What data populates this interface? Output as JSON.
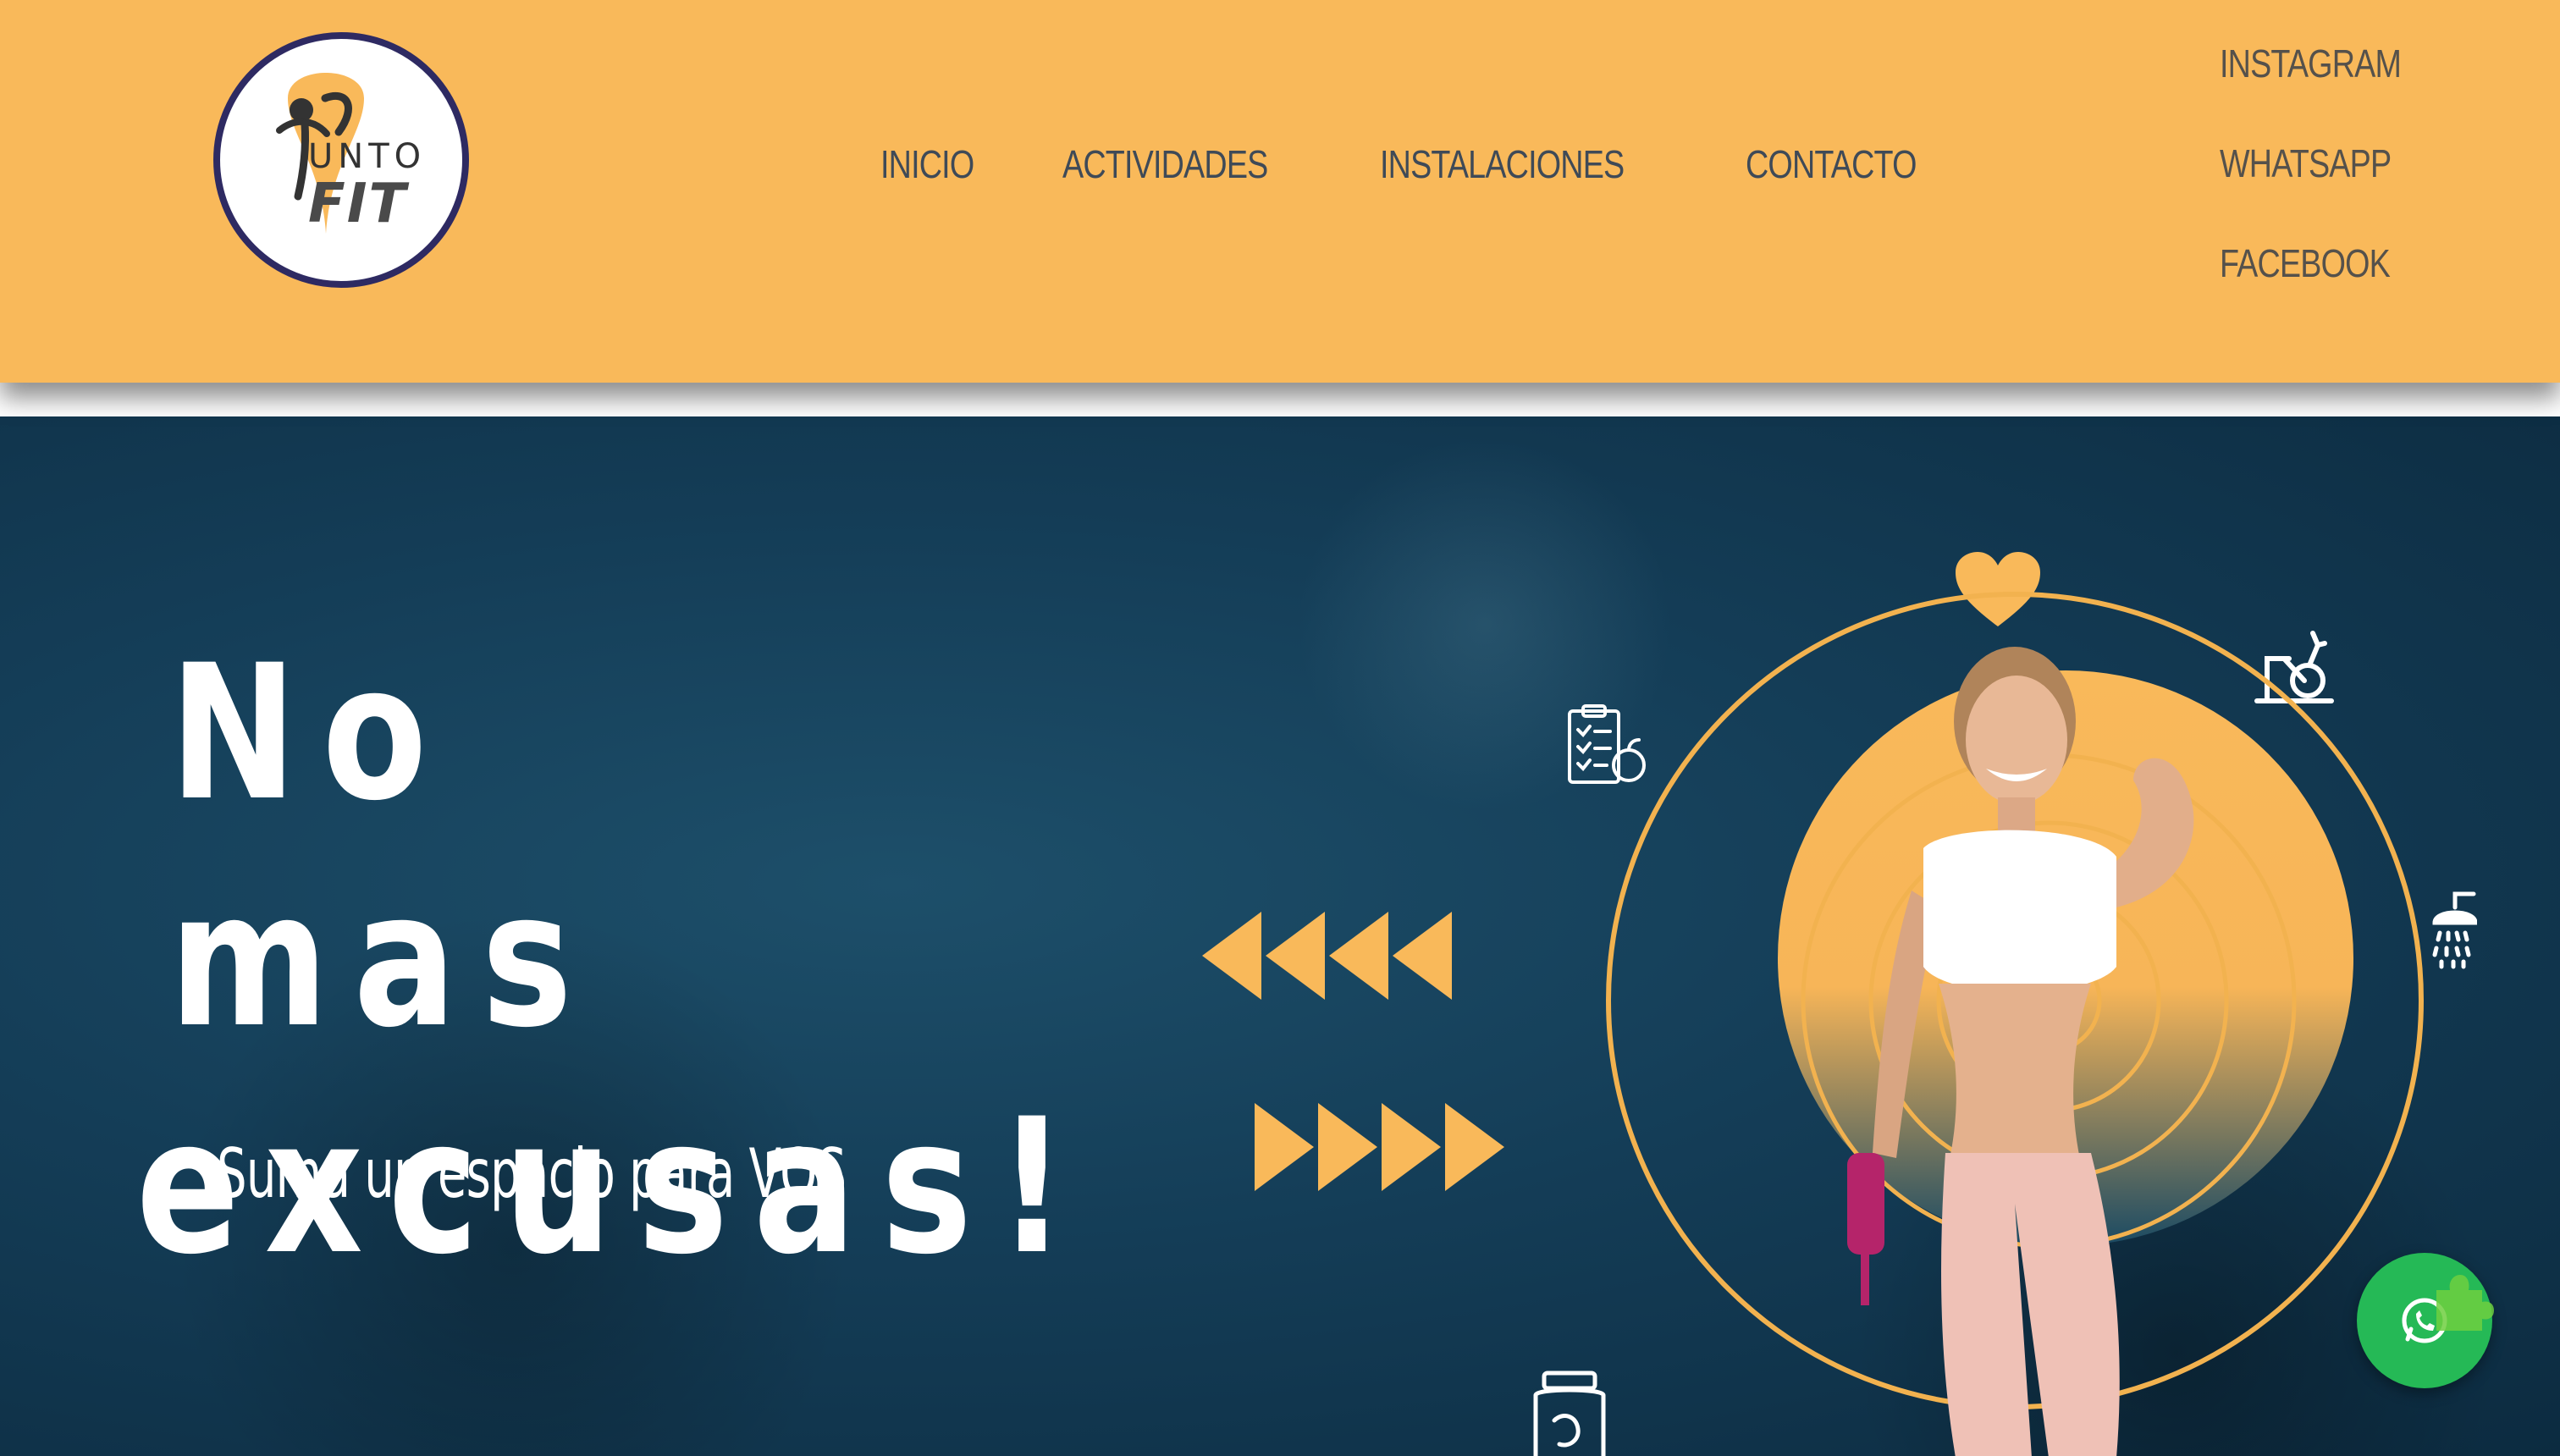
{
  "header": {
    "logo": {
      "text_top": "UNTO",
      "text_bottom": "FIT",
      "brand_colors": {
        "ring": "#2e2a62",
        "pin": "#f9b95a"
      }
    },
    "nav": [
      {
        "label": "INICIO"
      },
      {
        "label": "ACTIVIDADES"
      },
      {
        "label": "INSTALACIONES"
      },
      {
        "label": "CONTACTO"
      }
    ],
    "social": [
      {
        "label": "INSTAGRAM"
      },
      {
        "label": "WHATSAPP"
      },
      {
        "label": "FACEBOOK"
      }
    ],
    "background_color": "#f9b95a"
  },
  "hero": {
    "headline_line1": "No mas",
    "headline_line2": "excusas!",
    "subline": "Suma un espacio para VOS",
    "accent_color": "#f9b95a",
    "background_color": "#143d57",
    "icons": [
      "heart-icon",
      "stationary-bike-icon",
      "nutrition-plan-icon",
      "shower-icon",
      "supplement-jar-icon",
      "rewind-arrows-icon",
      "forward-arrows-icon"
    ]
  },
  "floating": {
    "whatsapp_button_color": "#25b956",
    "icon": "whatsapp-icon"
  }
}
